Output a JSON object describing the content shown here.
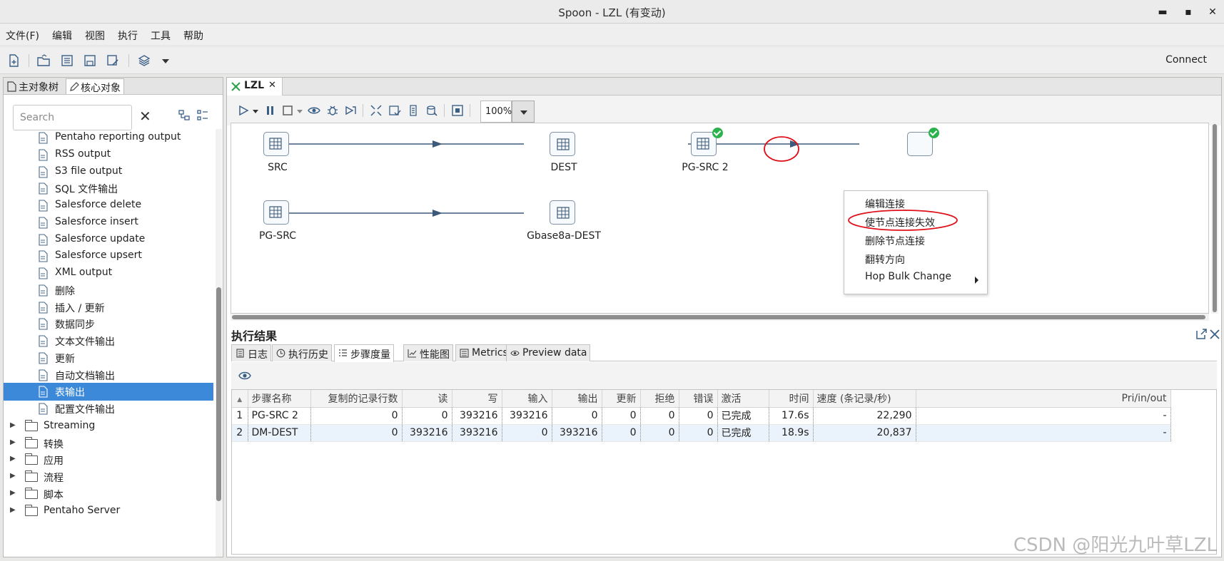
{
  "window": {
    "title": "Spoon - LZL (有变动)",
    "minimize": "▬",
    "maximize": "▪",
    "close": "✕"
  },
  "menu": [
    "文件(F)",
    "编辑",
    "视图",
    "执行",
    "工具",
    "帮助"
  ],
  "toolbar": {
    "connect": "Connect"
  },
  "left_panel": {
    "tabs": [
      "主对象树",
      "核心对象"
    ],
    "search_placeholder": "Search",
    "items": [
      {
        "label": "Pentaho reporting output"
      },
      {
        "label": "RSS output"
      },
      {
        "label": "S3 file output"
      },
      {
        "label": "SQL 文件输出"
      },
      {
        "label": "Salesforce delete"
      },
      {
        "label": "Salesforce insert"
      },
      {
        "label": "Salesforce update"
      },
      {
        "label": "Salesforce upsert"
      },
      {
        "label": "XML output"
      },
      {
        "label": "删除"
      },
      {
        "label": "插入 / 更新"
      },
      {
        "label": "数据同步"
      },
      {
        "label": "文本文件输出"
      },
      {
        "label": "更新"
      },
      {
        "label": "自动文档输出"
      },
      {
        "label": "表输出",
        "selected": true
      },
      {
        "label": "配置文件输出"
      }
    ],
    "folders": [
      "Streaming",
      "转换",
      "应用",
      "流程",
      "脚本",
      "Pentaho Server"
    ]
  },
  "editor": {
    "tab_label": "LZL",
    "zoom": "100%",
    "steps": [
      {
        "name": "SRC"
      },
      {
        "name": "DEST"
      },
      {
        "name": "PG-SRC 2",
        "completed": true
      },
      {
        "name": "PG-SRC"
      },
      {
        "name": "Gbase8a-DEST"
      }
    ],
    "context_menu": [
      "编辑连接",
      "使节点连接失效",
      "删除节点连接",
      "翻转方向",
      "Hop Bulk Change"
    ]
  },
  "results": {
    "title": "执行结果",
    "tabs": [
      "日志",
      "执行历史",
      "步骤度量",
      "性能图",
      "Metrics",
      "Preview data"
    ],
    "columns": [
      "步骤名称",
      "复制的记录行数",
      "读",
      "写",
      "输入",
      "输出",
      "更新",
      "拒绝",
      "错误",
      "激活",
      "时间",
      "速度 (条记录/秒)",
      "Pri/in/out"
    ],
    "rows": [
      [
        "1",
        "PG-SRC 2",
        "0",
        "0",
        "393216",
        "393216",
        "0",
        "0",
        "0",
        "0",
        "已完成",
        "17.6s",
        "22,290",
        "-"
      ],
      [
        "2",
        "DM-DEST",
        "0",
        "393216",
        "393216",
        "0",
        "393216",
        "0",
        "0",
        "0",
        "已完成",
        "18.9s",
        "20,837",
        "-"
      ]
    ]
  },
  "watermark": "CSDN @阳光九叶草LZL",
  "colors": {
    "selection": "#3c89d9",
    "annotation": "#e0101a",
    "success": "#2bb24c",
    "hop": "#3d5a7a"
  }
}
